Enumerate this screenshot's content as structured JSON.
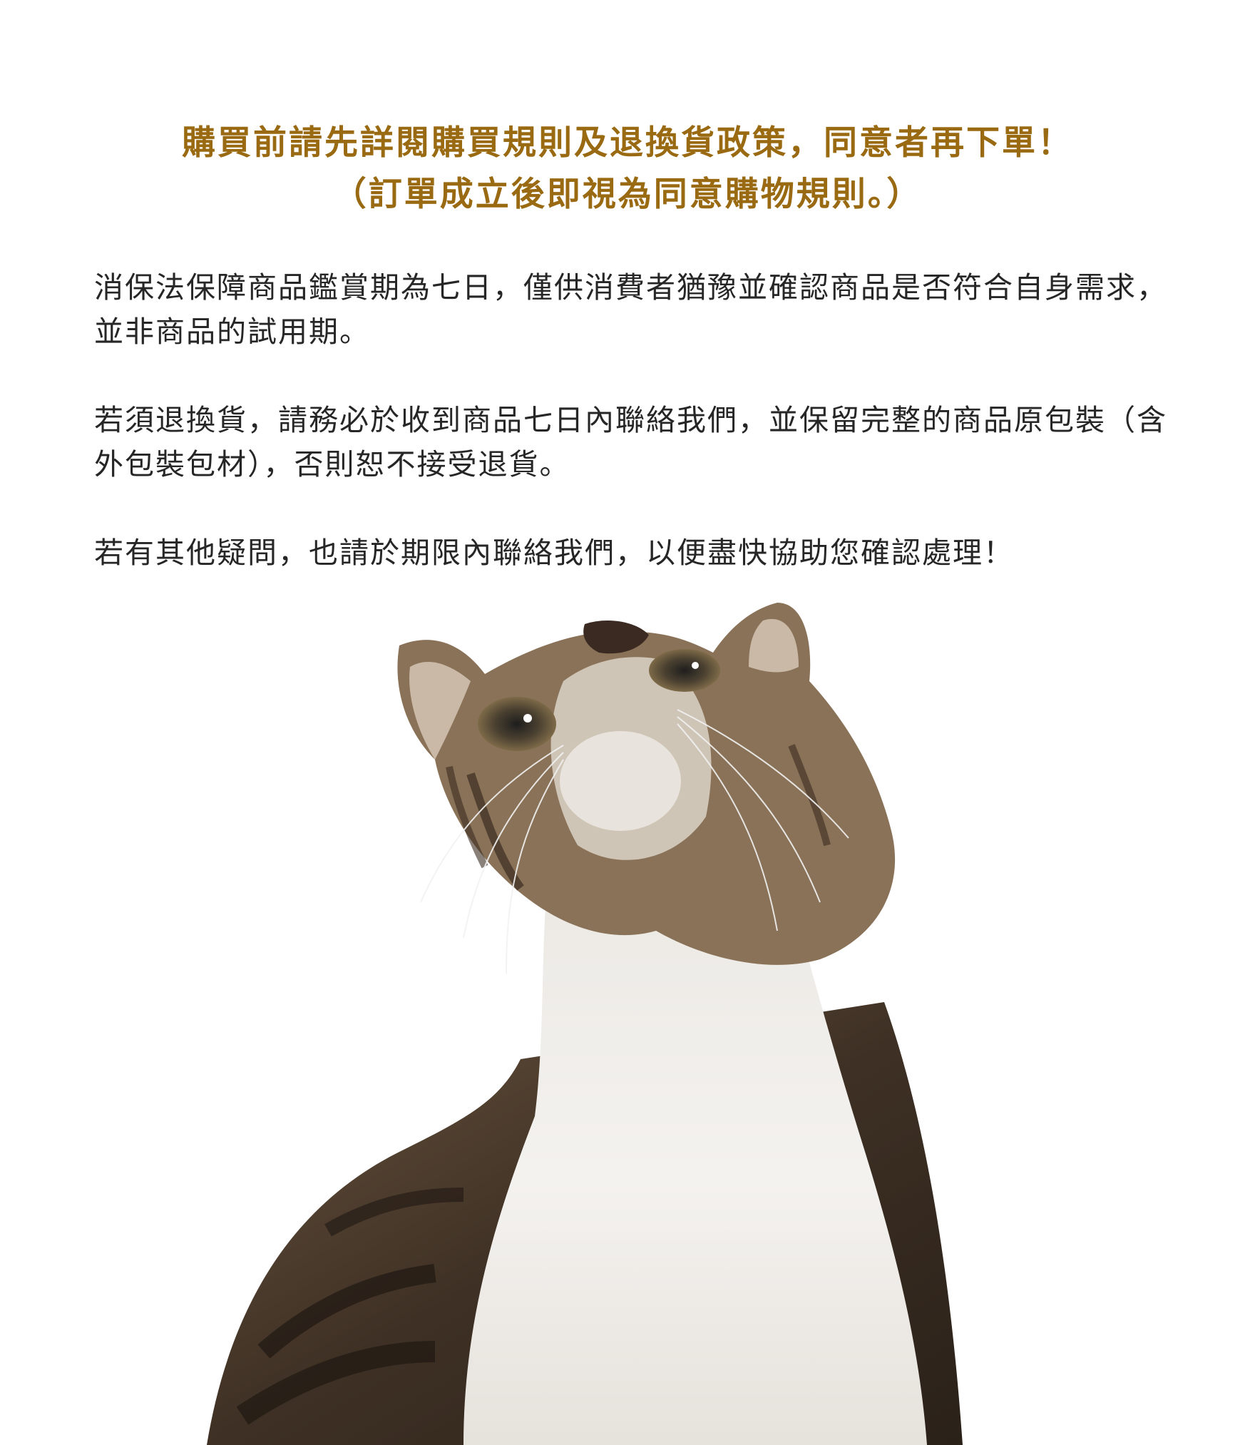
{
  "notice": {
    "headline_line1": "購買前請先詳閱購買規則及退換貨政策，同意者再下單！",
    "headline_line2": "（訂單成立後即視為同意購物規則。）",
    "paragraphs": [
      "消保法保障商品鑑賞期為七日，僅供消費者猶豫並確認商品是否符合自身需求，\n並非商品的試用期。",
      "若須退換貨，請務必於收到商品七日內聯絡我們，並保留完整的商品原包裝（含\n外包裝包材），否則恕不接受退貨。",
      "若有其他疑問，也請於期限內聯絡我們，以便盡快協助您確認處理！"
    ]
  },
  "colors": {
    "headline": "#9a6a12",
    "body_text": "#262626",
    "background": "#ffffff"
  },
  "image": {
    "subject": "tabby-and-white-cat-looking-up"
  }
}
